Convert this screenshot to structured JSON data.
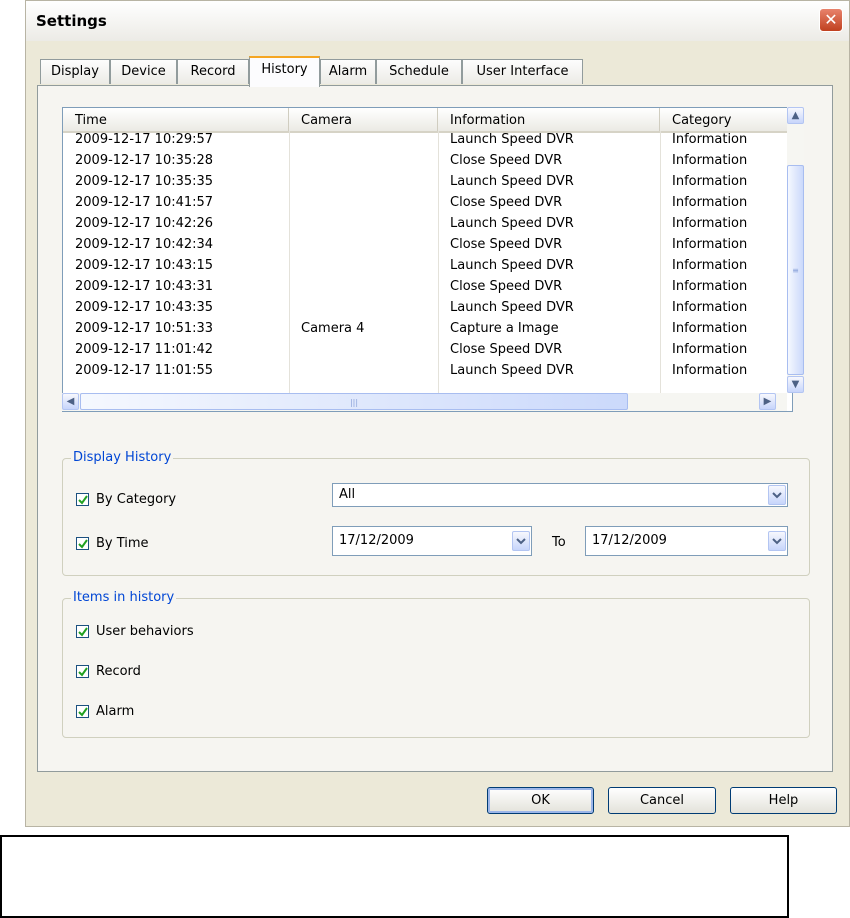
{
  "window": {
    "title": "Settings"
  },
  "tabs": [
    {
      "label": "Display"
    },
    {
      "label": "Device"
    },
    {
      "label": "Record"
    },
    {
      "label": "History",
      "active": true
    },
    {
      "label": "Alarm"
    },
    {
      "label": "Schedule"
    },
    {
      "label": "User Interface"
    }
  ],
  "history_table": {
    "columns": [
      "Time",
      "Camera",
      "Information",
      "Category"
    ],
    "rows": [
      [
        "2009-12-17 10:29:57",
        "",
        "Launch Speed DVR",
        "Information"
      ],
      [
        "2009-12-17 10:35:28",
        "",
        "Close Speed DVR",
        "Information"
      ],
      [
        "2009-12-17 10:35:35",
        "",
        "Launch Speed DVR",
        "Information"
      ],
      [
        "2009-12-17 10:41:57",
        "",
        "Close Speed DVR",
        "Information"
      ],
      [
        "2009-12-17 10:42:26",
        "",
        "Launch Speed DVR",
        "Information"
      ],
      [
        "2009-12-17 10:42:34",
        "",
        "Close Speed DVR",
        "Information"
      ],
      [
        "2009-12-17 10:43:15",
        "",
        "Launch Speed DVR",
        "Information"
      ],
      [
        "2009-12-17 10:43:31",
        "",
        "Close Speed DVR",
        "Information"
      ],
      [
        "2009-12-17 10:43:35",
        "",
        "Launch Speed DVR",
        "Information"
      ],
      [
        "2009-12-17 10:51:33",
        "Camera 4",
        "Capture a Image",
        "Information"
      ],
      [
        "2009-12-17 11:01:42",
        "",
        "Close Speed DVR",
        "Information"
      ],
      [
        "2009-12-17 11:01:55",
        "",
        "Launch Speed DVR",
        "Information"
      ]
    ]
  },
  "display_history": {
    "legend": "Display History",
    "by_category": {
      "label": "By Category",
      "checked": true,
      "selected": "All"
    },
    "by_time": {
      "label": "By Time",
      "checked": true,
      "from": "17/12/2009",
      "to_label": "To",
      "to": "17/12/2009"
    }
  },
  "items_in_history": {
    "legend": "Items in history",
    "items": [
      {
        "label": "User behaviors",
        "checked": true
      },
      {
        "label": "Record",
        "checked": true
      },
      {
        "label": "Alarm",
        "checked": true
      }
    ]
  },
  "buttons": {
    "ok": "OK",
    "cancel": "Cancel",
    "help": "Help"
  },
  "colors": {
    "accent_tab": "#f5a623",
    "group_legend": "#0046d5",
    "checkmark": "#21a121",
    "close": "#c0401f"
  },
  "icons": {
    "close": "close-icon",
    "check": "checkmark-icon",
    "dropdown": "chevron-down-icon"
  }
}
